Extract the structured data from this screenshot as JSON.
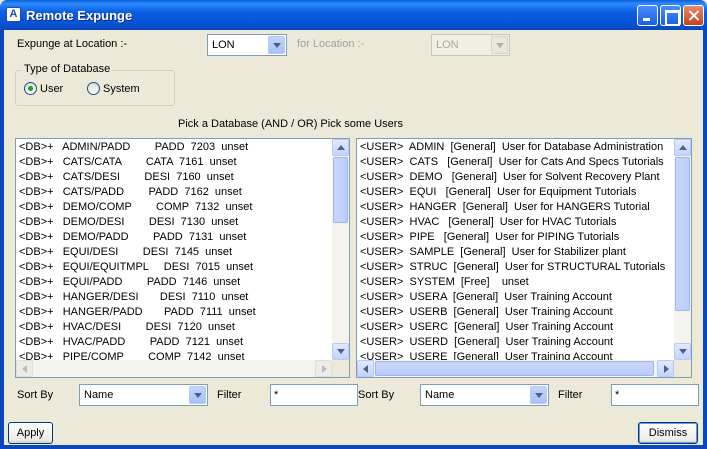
{
  "window": {
    "title": "Remote Expunge"
  },
  "location": {
    "label": "Expunge at Location :-",
    "value": "LON",
    "for_label": "for Location :-",
    "for_value": "LON"
  },
  "database_type": {
    "title": "Type of Database",
    "options": [
      "User",
      "System"
    ],
    "selected": "User"
  },
  "pick_label": "Pick a Database (AND / OR) Pick some Users",
  "left_list": [
    "<DB>+   ADMIN/PADD        PADD  7203  unset",
    "<DB>+   CATS/CATA        CATA  7161  unset",
    "<DB>+   CATS/DESI        DESI  7160  unset",
    "<DB>+   CATS/PADD        PADD  7162  unset",
    "<DB>+   DEMO/COMP        COMP  7132  unset",
    "<DB>+   DEMO/DESI        DESI  7130  unset",
    "<DB>+   DEMO/PADD        PADD  7131  unset",
    "<DB>+   EQUI/DESI        DESI  7145  unset",
    "<DB>+   EQUI/EQUITMPL     DESI  7015  unset",
    "<DB>+   EQUI/PADD        PADD  7146  unset",
    "<DB>+   HANGER/DESI       DESI  7110  unset",
    "<DB>+   HANGER/PADD       PADD  7111  unset",
    "<DB>+   HVAC/DESI        DESI  7120  unset",
    "<DB>+   HVAC/PADD        PADD  7121  unset",
    "<DB>+   PIPE/COMP        COMP  7142  unset"
  ],
  "right_list": [
    "<USER>  ADMIN  [General]  User for Database Administration",
    "<USER>  CATS   [General]  User for Cats And Specs Tutorials",
    "<USER>  DEMO   [General]  User for Solvent Recovery Plant",
    "<USER>  EQUI   [General]  User for Equipment Tutorials",
    "<USER>  HANGER  [General]  User for HANGERS Tutorial",
    "<USER>  HVAC   [General]  User for HVAC Tutorials",
    "<USER>  PIPE   [General]  User for PIPING Tutorials",
    "<USER>  SAMPLE  [General]  User for Stabilizer plant",
    "<USER>  STRUC  [General]  User for STRUCTURAL Tutorials",
    "<USER>  SYSTEM  [Free]    unset",
    "<USER>  USERA  [General]  User Training Account",
    "<USER>  USERB  [General]  User Training Account",
    "<USER>  USERC  [General]  User Training Account",
    "<USER>  USERD  [General]  User Training Account",
    "<USER>  USERE  [General]  User Training Account"
  ],
  "left_controls": {
    "sort_label": "Sort By",
    "sort_value": "Name",
    "filter_label": "Filter",
    "filter_value": "*"
  },
  "right_controls": {
    "sort_label": "Sort By",
    "sort_value": "Name",
    "filter_label": "Filter",
    "filter_value": "*"
  },
  "buttons": {
    "apply": "Apply",
    "dismiss": "Dismiss"
  }
}
